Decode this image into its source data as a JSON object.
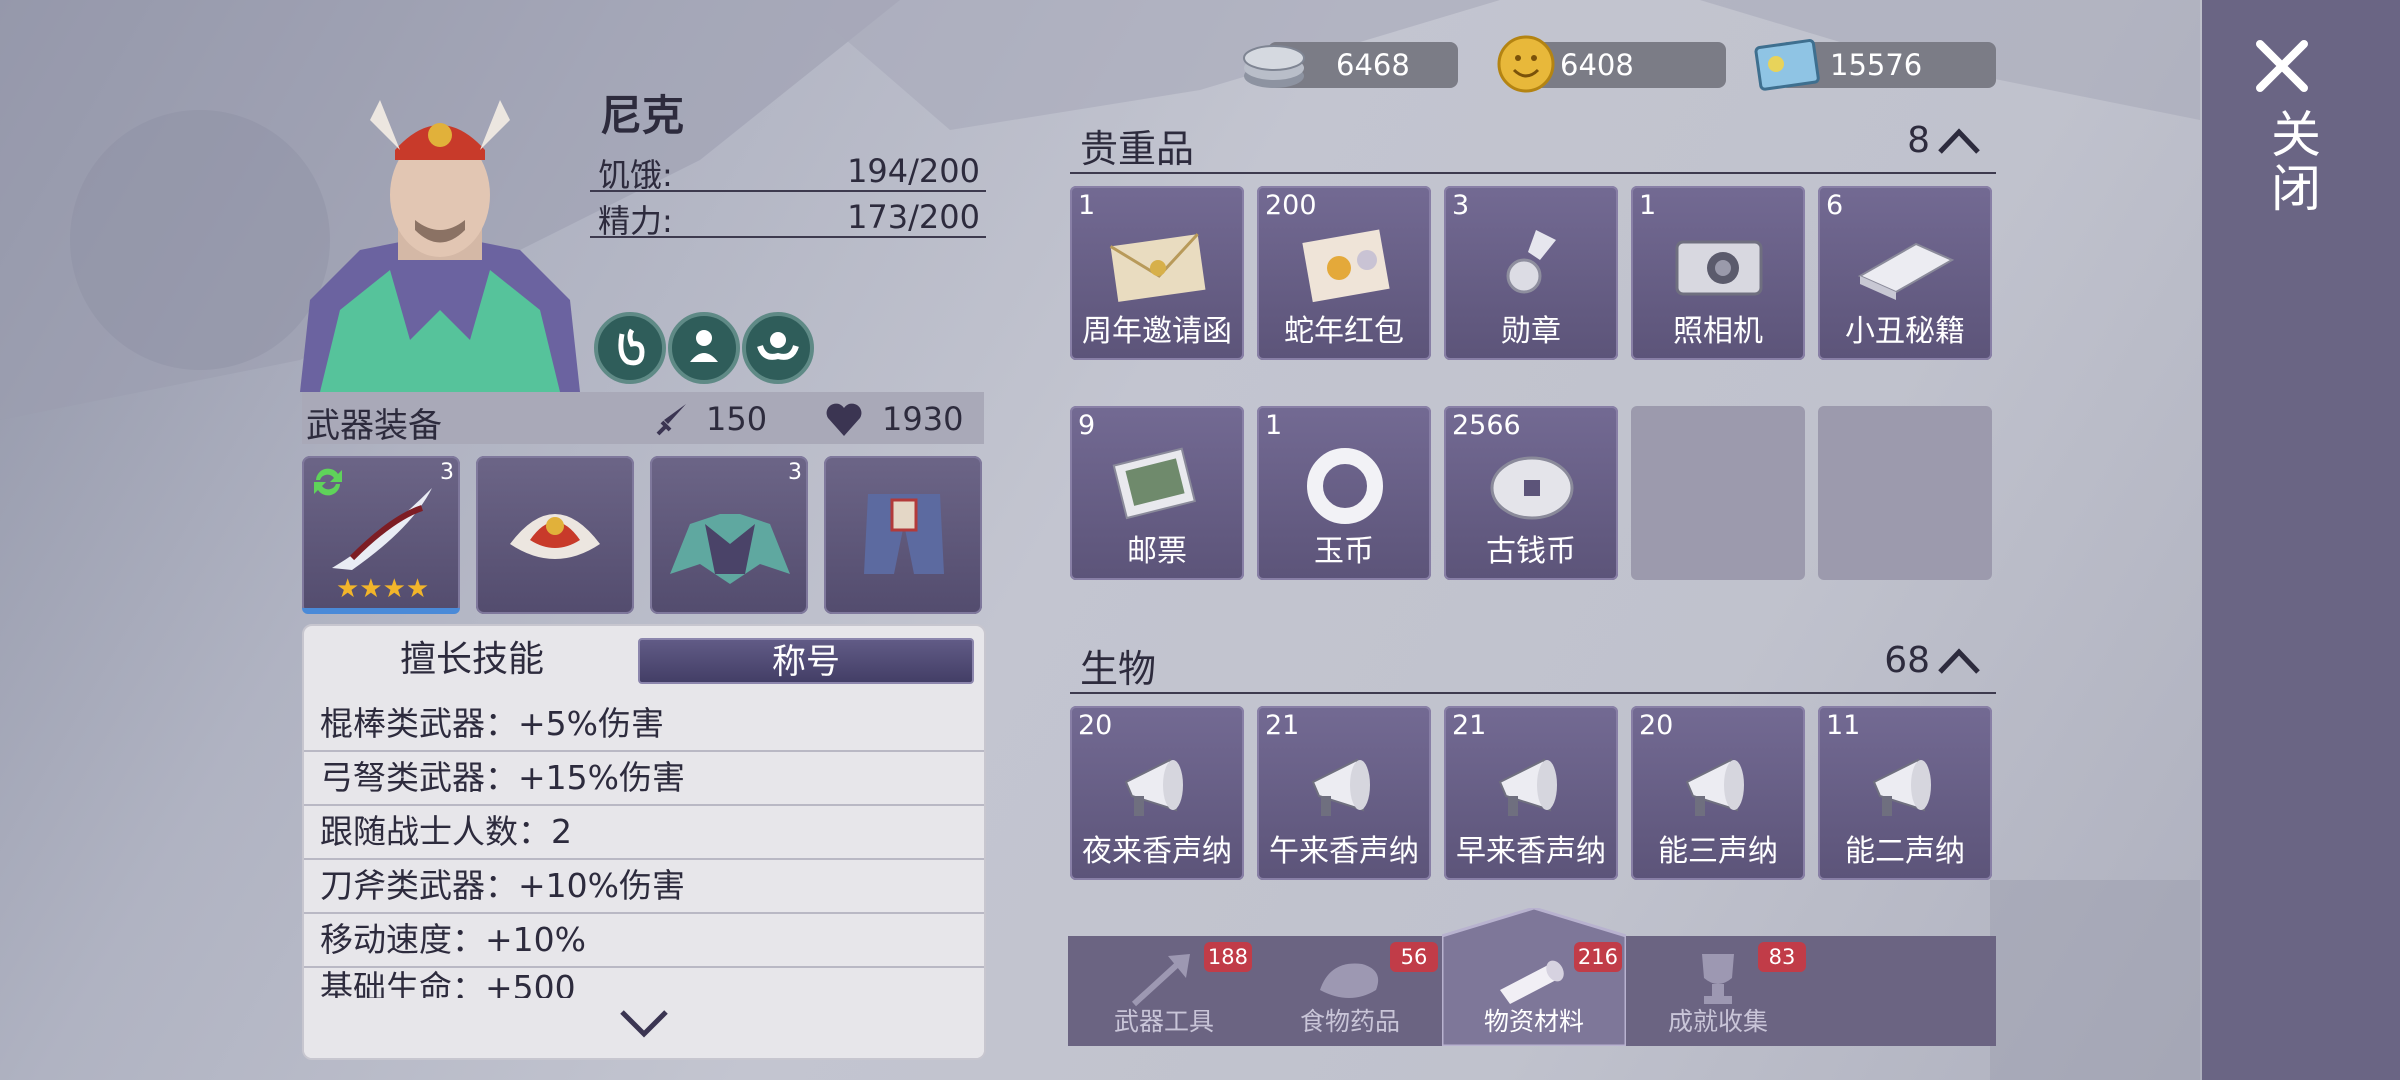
{
  "currencies": [
    {
      "icon": "silver-coin-icon",
      "value": "6468"
    },
    {
      "icon": "gold-smile-coin-icon",
      "value": "6408"
    },
    {
      "icon": "ticket-icon",
      "value": "15576"
    }
  ],
  "close_label": "关闭",
  "character": {
    "name": "尼克",
    "stats": [
      {
        "label": "饥饿:",
        "value": "194/200"
      },
      {
        "label": "精力:",
        "value": "173/200"
      }
    ],
    "status_icons": [
      "stomach-icon",
      "person-icon",
      "strength-icon"
    ]
  },
  "weapons": {
    "title": "武器装备",
    "attack": "150",
    "health": "1930",
    "slots": [
      {
        "icon": "blade-weapon-icon",
        "level": "3",
        "stars": "★★★★"
      },
      {
        "icon": "crown-helmet-icon",
        "level": ""
      },
      {
        "icon": "armor-icon",
        "level": "3"
      },
      {
        "icon": "pants-icon",
        "level": ""
      }
    ]
  },
  "skills": {
    "tab_specialty": "擅长技能",
    "tab_title": "称号",
    "rows": [
      "棍棒类武器：+5%伤害",
      "弓弩类武器：+15%伤害",
      "跟随战士人数：2",
      "刀斧类武器：+10%伤害",
      "移动速度：+10%",
      "基础生命：+500"
    ]
  },
  "valuables": {
    "title": "贵重品",
    "count": "8",
    "items": [
      {
        "count": "1",
        "name": "周年邀请函",
        "icon": "envelope-icon"
      },
      {
        "count": "200",
        "name": "蛇年红包",
        "icon": "red-envelope-icon"
      },
      {
        "count": "3",
        "name": "勋章",
        "icon": "medal-icon"
      },
      {
        "count": "1",
        "name": "照相机",
        "icon": "camera-icon"
      },
      {
        "count": "6",
        "name": "小丑秘籍",
        "icon": "book-icon"
      },
      {
        "count": "9",
        "name": "邮票",
        "icon": "stamps-icon"
      },
      {
        "count": "1",
        "name": "玉币",
        "icon": "jade-ring-icon"
      },
      {
        "count": "2566",
        "name": "古钱币",
        "icon": "ancient-coin-icon"
      }
    ]
  },
  "creatures": {
    "title": "生物",
    "count": "68",
    "items": [
      {
        "count": "20",
        "name": "夜来香声纳"
      },
      {
        "count": "21",
        "name": "午来香声纳"
      },
      {
        "count": "21",
        "name": "早来香声纳"
      },
      {
        "count": "20",
        "name": "能三声纳"
      },
      {
        "count": "11",
        "name": "能二声纳"
      }
    ]
  },
  "bottom_tabs": [
    {
      "label": "武器工具",
      "badge": "188",
      "icon": "axe-icon"
    },
    {
      "label": "食物药品",
      "badge": "56",
      "icon": "meat-icon"
    },
    {
      "label": "物资材料",
      "badge": "216",
      "icon": "wood-log-icon",
      "active": true
    },
    {
      "label": "成就收集",
      "badge": "83",
      "icon": "trophy-icon"
    }
  ]
}
